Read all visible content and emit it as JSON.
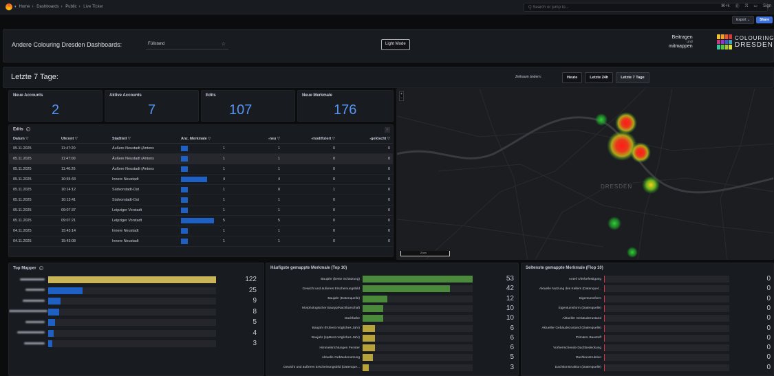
{
  "nav": {
    "breadcrumb": [
      "Home",
      "Dashboards",
      "Public",
      "Live Ticker"
    ],
    "search_placeholder": "Q Search or jump to...",
    "right": [
      "⌘+k"
    ]
  },
  "toolbar": {
    "export": "Export ⌄",
    "share": "Share"
  },
  "header": {
    "andere": "Andere Colouring Dresden Dashboards:",
    "fuellstand": "Füllstand",
    "light_mode": "Light Mode",
    "beitragen": "Beitragen",
    "und": "und",
    "mitmappen": "mitmappen",
    "brand1": "COLOURING",
    "brand2": "DRESDEN"
  },
  "range": {
    "title": "Letzte 7 Tage:",
    "zeitraum": "Zeitraum ändern:",
    "buttons": [
      "Heute",
      "Letzte 24h",
      "Letzte 7 Tage"
    ]
  },
  "stats": [
    {
      "label": "Neue Accounts",
      "value": "2"
    },
    {
      "label": "Aktive Accounts",
      "value": "7"
    },
    {
      "label": "Edits",
      "value": "107"
    },
    {
      "label": "Neue Merkmale",
      "value": "176"
    }
  ],
  "edits": {
    "title": "Edits",
    "columns": [
      "Datum ▽",
      "Uhrzeit ▽",
      "Stadtteil ▽",
      "Anz. Merkmale ▽",
      "-neu ▽",
      "-modifiziert ▽",
      "-gelöscht ▽"
    ],
    "rows": [
      [
        "05.11.2025",
        "11:47:20",
        "Äußere Neustadt (Antons",
        "1",
        "1",
        "0",
        "0"
      ],
      [
        "05.11.2025",
        "11:47:00",
        "Äußere Neustadt (Antons",
        "1",
        "1",
        "0",
        "0"
      ],
      [
        "05.11.2025",
        "11:46:26",
        "Äußere Neustadt (Antons",
        "1",
        "1",
        "0",
        "0"
      ],
      [
        "05.11.2025",
        "10:55:43",
        "Innere Neustadt",
        "4",
        "4",
        "0",
        "0"
      ],
      [
        "05.11.2025",
        "10:14:12",
        "Südvorstadt-Ost",
        "1",
        "0",
        "1",
        "0"
      ],
      [
        "05.11.2025",
        "10:13:41",
        "Südvorstadt-Ost",
        "1",
        "1",
        "0",
        "0"
      ],
      [
        "05.11.2025",
        "09:07:37",
        "Leipziger Vorstadt",
        "1",
        "1",
        "0",
        "0"
      ],
      [
        "05.11.2025",
        "09:07:21",
        "Leipziger Vorstadt",
        "5",
        "5",
        "0",
        "0"
      ],
      [
        "04.11.2025",
        "15:43:14",
        "Innere Neustadt",
        "1",
        "1",
        "0",
        "0"
      ],
      [
        "04.11.2025",
        "15:43:08",
        "Innere Neustadt",
        "1",
        "1",
        "0",
        "0"
      ]
    ]
  },
  "map": {
    "label": "DRESDEN",
    "scale": "2 km",
    "zoom_in": "+",
    "zoom_out": "−"
  },
  "top_mapper": {
    "title": "Top Mapper",
    "values": [
      122,
      25,
      9,
      8,
      5,
      4,
      3
    ],
    "max": 122,
    "color": "#c9b458"
  },
  "haeufigste": {
    "title": "Häufigste gemappte Merkmale (Top 10)",
    "labels": [
      "Baujahr (beste Schätzung)",
      "Gewicht und äußeres Erscheinungsbild",
      "Baujahr (Datenquelle)",
      "Morphologischer Bautyp/Nachbarschaft",
      "Dachfarbe",
      "Baujahr (frühest mögliches Jahr)",
      "Baujahr (spätest mögliches Jahr)",
      "Himmelsrichtungen Fenster",
      "Aktuelle Gebäudenutzung",
      "Gewicht und äußeres Erscheinungsbild (Datenque..."
    ],
    "values": [
      53,
      42,
      12,
      10,
      10,
      6,
      6,
      6,
      5,
      3
    ],
    "max": 53
  },
  "seltenste": {
    "title": "Seltenste gemappte Merkmale (Flop 10)",
    "labels": [
      "Anteil Uferbefestigung",
      "Aktuelle Nutzung des Kellers (Datenquel...",
      "Eigentumsform",
      "Eigentumsform (Datenquelle)",
      "Aktueller Gebäudezustand",
      "Aktueller Gebäudezustand (Datenquelle)",
      "Primärer Baustoff",
      "Vorherrschende Dachbedeckung",
      "Dachkonstruktion",
      "Dachkonstruktion (Datenquelle)"
    ],
    "values": [
      0,
      0,
      0,
      0,
      0,
      0,
      0,
      0,
      0,
      0
    ]
  }
}
